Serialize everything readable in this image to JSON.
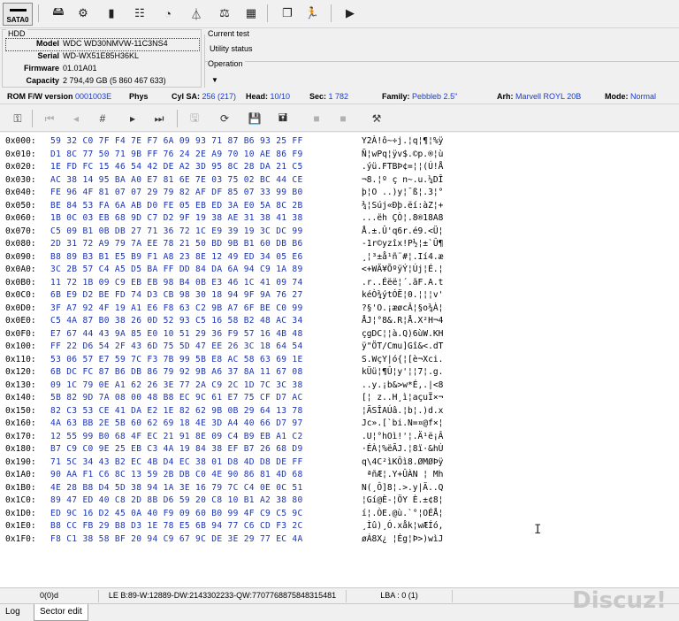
{
  "toolbar": {
    "sata_label": "SATA0",
    "icons": [
      "drive-icon",
      "settings-icon",
      "chip-icon",
      "tree-icon",
      "disk-icon",
      "flask-icon",
      "scale-icon",
      "grid-icon",
      "copy-icon",
      "runner-icon",
      "play-icon"
    ]
  },
  "hdd": {
    "group_title": "HDD",
    "model_label": "Model",
    "model": "WDC WD30NMVW-11C3NS4",
    "serial_label": "Serial",
    "serial": "WD-WX51E85H36KL",
    "firmware_label": "Firmware",
    "firmware": "01.01A01",
    "capacity_label": "Capacity",
    "capacity": "2 794,49 GB (5 860 467 633)"
  },
  "test": {
    "current_test_label": "Current test",
    "status": "Utility status",
    "operation_label": "Operation"
  },
  "info": {
    "rom_label": "ROM F/W version",
    "rom_value": "0001003E",
    "phys_label": "Phys",
    "cylsa_label": "Cyl SA:",
    "cylsa_value": "256 (217)",
    "head_label": "Head:",
    "head_value": "10/10",
    "sec_label": "Sec:",
    "sec_value": "1 782",
    "family_label": "Family:",
    "family_value": "Pebbleb 2.5\"",
    "arh_label": "Arh:",
    "arh_value": "Marvell ROYL 20B",
    "mode_label": "Mode:",
    "mode_value": "Normal"
  },
  "hex": {
    "rows": [
      {
        "addr": "0x000:",
        "bytes": "59 32 C0 7F F4 7E F7 6A 09 93 71 87 B6 93 25 FF",
        "ascii": "Y2À!ô~÷j.¦q¦¶¦%ÿ"
      },
      {
        "addr": "0x010:",
        "bytes": "D1 8C 77 50 71 9B FF 76 24 2E A9 70 10 AE 86 F9",
        "ascii": "Ñ¦wPq¦ÿv$.©p.®¦ù"
      },
      {
        "addr": "0x020:",
        "bytes": "1E FD FC 15 46 54 42 DE A2 3D 95 8C 28 DA 21 C5",
        "ascii": ".ýü.FTBÞ¢=¦¦(Ú!Å"
      },
      {
        "addr": "0x030:",
        "bytes": "AC 38 14 95 BA A0 E7 81 6E 7E 03 75 02 BC 44 CE",
        "ascii": "¬8.¦º ç n~.u.¼DÎ"
      },
      {
        "addr": "0x040:",
        "bytes": "FE 96 4F 81 07 07 29 79 82 AF DF 85 07 33 99 B0",
        "ascii": "þ¦O ..)y¦¯ß¦.3¦°"
      },
      {
        "addr": "0x050:",
        "bytes": "BE 84 53 FA 6A AB D0 FE 05 EB ED 3A E0 5A 8C 2B",
        "ascii": "¾¦Súj«Ðþ.ëí:àZ¦+"
      },
      {
        "addr": "0x060:",
        "bytes": "1B 0C 03 EB 68 9D C7 D2 9F 19 38 AE 31 38 41 38",
        "ascii": "...ëh ÇÒ¦.8®18A8"
      },
      {
        "addr": "0x070:",
        "bytes": "C5 09 B1 0B DB 27 71 36 72 1C E9 39 19 3C DC 99",
        "ascii": "Å.±.Û'q6r.é9.<Ü¦"
      },
      {
        "addr": "0x080:",
        "bytes": "2D 31 72 A9 79 7A EE 78 21 50 BD 9B B1 60 DB B6",
        "ascii": "-1r©yzîx!P½¦±`Û¶"
      },
      {
        "addr": "0x090:",
        "bytes": "B8 89 B3 B1 E5 B9 F1 A8 23 8E 12 49 ED 34 05 E6",
        "ascii": "¸¦³±å¹ñ¨#¦.Ií4.æ"
      },
      {
        "addr": "0x0A0:",
        "bytes": "3C 2B 57 C4 A5 D5 BA FF DD 84 DA 6A 94 C9 1A 89",
        "ascii": "<+WÄ¥ÕºÿÝ¦Új¦É.¦"
      },
      {
        "addr": "0x0B0:",
        "bytes": "11 72 1B 09 C9 EB EB 98 B4 0B E3 46 1C 41 09 74",
        "ascii": ".r..Éëë¦´.ãF.A.t"
      },
      {
        "addr": "0x0C0:",
        "bytes": "6B E9 D2 BE FD 74 D3 CB 98 30 18 94 9F 9A 76 27",
        "ascii": "kéÒ¾ýtÓË¦0.¦¦¦v'"
      },
      {
        "addr": "0x0D0:",
        "bytes": "3F A7 92 4F 19 A1 E6 F8 63 C2 9B A7 6F BE C0 99",
        "ascii": "?§'O.¡æøcÂ¦§o¾À¦"
      },
      {
        "addr": "0x0E0:",
        "bytes": "C5 4A 87 B0 38 26 0D 52 93 C5 16 58 B2 48 AC 34",
        "ascii": "ÅJ¦°8&.R¦Å.X²H¬4"
      },
      {
        "addr": "0x0F0:",
        "bytes": "E7 67 44 43 9A 85 E0 10 51 29 36 F9 57 16 4B 48",
        "ascii": "çgDC¦¦à.Q)6ùW.KH"
      },
      {
        "addr": "0x100:",
        "bytes": "FF 22 D6 54 2F 43 6D 75 5D 47 EE 26 3C 18 64 54",
        "ascii": "ÿ\"ÖT/Cmu]Gî&<.dT"
      },
      {
        "addr": "0x110:",
        "bytes": "53 06 57 E7 59 7C F3 7B 99 5B E8 AC 58 63 69 1E",
        "ascii": "S.WçY|ó{¦[è¬Xci."
      },
      {
        "addr": "0x120:",
        "bytes": "6B DC FC 87 B6 DB 86 79 92 9B A6 37 8A 11 67 08",
        "ascii": "kÜü¦¶Û¦y'¦¦7¦.g."
      },
      {
        "addr": "0x130:",
        "bytes": "09 1C 79 0E A1 62 26 3E 77 2A C9 2C 1D 7C 3C 38",
        "ascii": "..y.¡b&>w*É,.|<8"
      },
      {
        "addr": "0x140:",
        "bytes": "5B 82 9D 7A 08 00 48 B8 EC 9C 61 E7 75 CF D7 AC",
        "ascii": "[¦ z..H¸ì¦açuÏ×¬"
      },
      {
        "addr": "0x150:",
        "bytes": "82 C3 53 CE 41 DA E2 1E 82 62 9B 0B 29 64 13 78",
        "ascii": "¦ÃSÎAÚâ.¦b¦.)d.x"
      },
      {
        "addr": "0x160:",
        "bytes": "4A 63 BB 2E 5B 60 62 69 18 4E 3D A4 40 66 D7 97",
        "ascii": "Jc».[`bi.N=¤@f×¦"
      },
      {
        "addr": "0x170:",
        "bytes": "12 55 99 B0 68 4F EC 21 91 8E 09 C4 B9 EB A1 C2",
        "ascii": ".U¦°hOì!'¦.Ä¹ë¡Â"
      },
      {
        "addr": "0x180:",
        "bytes": "B7 C9 C0 9E 25 EB C3 4A 19 84 38 EF B7 26 68 D9",
        "ascii": "·ÉÀ¦%ëÃJ.¦8ï·&hÙ"
      },
      {
        "addr": "0x190:",
        "bytes": "71 5C 34 43 B2 EC 4B D4 EC 38 01 D8 4D D8 DE FF",
        "ascii": "q\\4C²ìKÔì8.ØMØÞÿ"
      },
      {
        "addr": "0x1A0:",
        "bytes": "90 AA F1 C6 8C 13 59 2B DB C0 4E 90 86 81 4D 68",
        "ascii": " ªñÆ¦.Y+ÛÀN ¦ Mh"
      },
      {
        "addr": "0x1B0:",
        "bytes": "4E 28 B8 D4 5D 38 94 1A 3E 16 79 7C C4 0E 0C 51",
        "ascii": "N(¸Ô]8¦.>.y|Ä..Q"
      },
      {
        "addr": "0x1C0:",
        "bytes": "89 47 ED 40 C8 2D 8B D6 59 20 C8 10 B1 A2 38 80",
        "ascii": "¦Gí@È-¦ÖY È.±¢8¦"
      },
      {
        "addr": "0x1D0:",
        "bytes": "ED 9C 16 D2 45 0A 40 F9 09 60 B0 99 4F C9 C5 9C",
        "ascii": "í¦.ÒE.@ù.`°¦OÉÅ¦"
      },
      {
        "addr": "0x1E0:",
        "bytes": "B8 CC FB 29 B8 D3 1E 78 E5 6B 94 77 C6 CD F3 2C",
        "ascii": "¸Ìû)¸Ó.xåk¦wÆÍó,"
      },
      {
        "addr": "0x1F0:",
        "bytes": "F8 C1 38 58 BF 20 94 C9 67 9C DE 3E 29 77 EC 4A",
        "ascii": "øÁ8X¿ ¦Ég¦Þ>)wìJ"
      }
    ]
  },
  "status": {
    "offset": "0(0)d",
    "le": "LE B:89-W:12889-DW:2143302233-QW:7707768875848315481",
    "lba": "LBA : 0 (1)"
  },
  "tabs": [
    {
      "label": "Log"
    },
    {
      "label": "Sector edit"
    }
  ],
  "watermark": "Discuz!"
}
